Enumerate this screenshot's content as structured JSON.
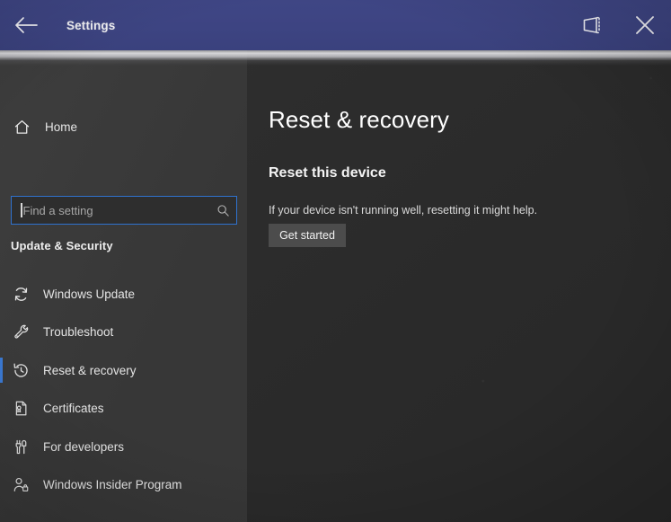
{
  "window": {
    "title": "Settings",
    "titlebar_color": "#3d4482",
    "back_icon": "back-arrow-icon",
    "project_icon": "project-screen-icon",
    "close_icon": "close-icon"
  },
  "sidebar": {
    "home": {
      "label": "Home",
      "icon": "home-icon"
    },
    "search": {
      "placeholder": "Find a setting",
      "icon": "search-icon",
      "focused": true,
      "value": ""
    },
    "group_header": "Update & Security",
    "accent_color": "#3b7ad4",
    "items": [
      {
        "label": "Windows Update",
        "icon": "sync-refresh-icon",
        "selected": false
      },
      {
        "label": "Troubleshoot",
        "icon": "wrench-icon",
        "selected": false
      },
      {
        "label": "Reset & recovery",
        "icon": "history-clock-icon",
        "selected": true
      },
      {
        "label": "Certificates",
        "icon": "certificate-document-icon",
        "selected": false
      },
      {
        "label": "For developers",
        "icon": "developer-tools-icon",
        "selected": false
      },
      {
        "label": "Windows Insider Program",
        "icon": "person-badge-icon",
        "selected": false
      }
    ]
  },
  "content": {
    "page_title": "Reset & recovery",
    "section_title": "Reset this device",
    "section_description": "If your device isn't running well, resetting it might help.",
    "get_started_label": "Get started"
  }
}
